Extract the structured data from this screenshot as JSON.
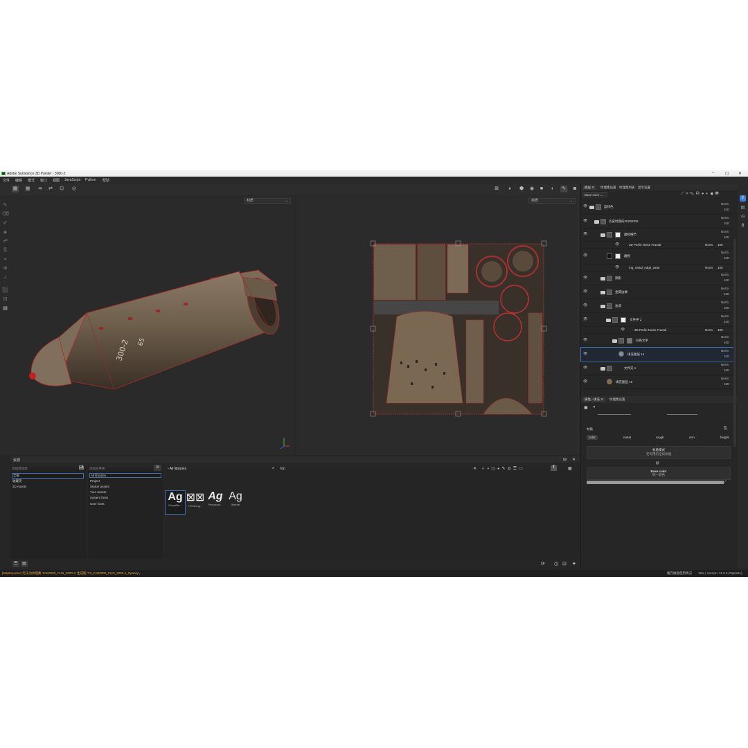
{
  "window": {
    "title": "Adobe Substance 3D Painter - 3000-2",
    "controls": [
      "–",
      "▢",
      "✕"
    ]
  },
  "menu": [
    "文件",
    "编辑",
    "模式",
    "窗口",
    "视图",
    "JavaScript",
    "Python",
    "帮助"
  ],
  "viewports": {
    "left_mode": "材质",
    "right_mode": "材质"
  },
  "layers_panel": {
    "tabs": [
      "图层",
      "纹理集设置",
      "纹理集列表",
      "显示设置"
    ],
    "channel": "Base color",
    "layers": [
      {
        "name": "蓝绿色",
        "blend": "Norm",
        "opacity": "100"
      },
      {
        "name": "历史时期的20200309",
        "blend": "Norm",
        "opacity": "100"
      },
      {
        "name": "磨损细节",
        "blend": "Norm",
        "opacity": "100"
      },
      {
        "name": "3D Perlin Noise Fractal",
        "blend": "Norm",
        "opacity": "100"
      },
      {
        "name": "磨损",
        "blend": "Norm",
        "opacity": "100"
      },
      {
        "name": "mg_metal_edge_wear",
        "blend": "Norm",
        "opacity": "100"
      },
      {
        "name": "阴影",
        "blend": "Norm",
        "opacity": "100"
      },
      {
        "name": "金属边缘",
        "blend": "Norm",
        "opacity": "100"
      },
      {
        "name": "油漆",
        "blend": "Norm",
        "opacity": "100"
      },
      {
        "name": "文件夹 2",
        "blend": "Norm",
        "opacity": "100"
      },
      {
        "name": "3D Perlin Noise Fractal",
        "blend": "Norm",
        "opacity": "100"
      },
      {
        "name": "白色文字",
        "blend": "Norm",
        "opacity": "100"
      },
      {
        "name": "填充图层 14",
        "blend": "Norm",
        "opacity": "100"
      },
      {
        "name": "文件夹 1",
        "blend": "Norm",
        "opacity": "100"
      },
      {
        "name": "填充图层 16",
        "blend": "Norm",
        "opacity": "100"
      }
    ]
  },
  "properties_panel": {
    "tabs": [
      "属性 - 填充",
      "纹理集设置"
    ],
    "section": "材质",
    "channels": [
      "color",
      "metal",
      "rough",
      "nrm",
      "height"
    ],
    "mode_title": "材质模式",
    "mode_value": "无可用的全局纹理",
    "subsection": "颜",
    "base_color_label": "Base color",
    "base_color_value": "统一颜色"
  },
  "assets": {
    "title": "资源",
    "left_placeholder": "添加到资源",
    "left_items": [
      "全部",
      "收藏夹",
      "3D Assets"
    ],
    "mid_placeholder": "添加文件夹",
    "mid_items": [
      "All libraries",
      "Project",
      "Starter assets",
      "Your assets",
      "System fonts",
      "User fonts"
    ],
    "breadcrumb": "All libraries",
    "search_value": "fon",
    "fonts": [
      {
        "glyph": "Ag",
        "name": "Cloud/Ne..."
      },
      {
        "glyph": "⊠⊠",
        "name": "HYZhong..."
      },
      {
        "glyph": "Ag",
        "name": "Proxxxxxx..."
      },
      {
        "glyph": "Ag",
        "name": "SimHei"
      }
    ]
  },
  "status": {
    "left": "[MapExporter] 无法为纹理集 'FAB3000_CHN_3000-2' 生成图 'TX_FAB3000_CHN_3000-2_Opacity'。",
    "right1": "缓存磁盘使用情况",
    "right2": "18% | Version: 11.0.0 (OpenGL)"
  }
}
